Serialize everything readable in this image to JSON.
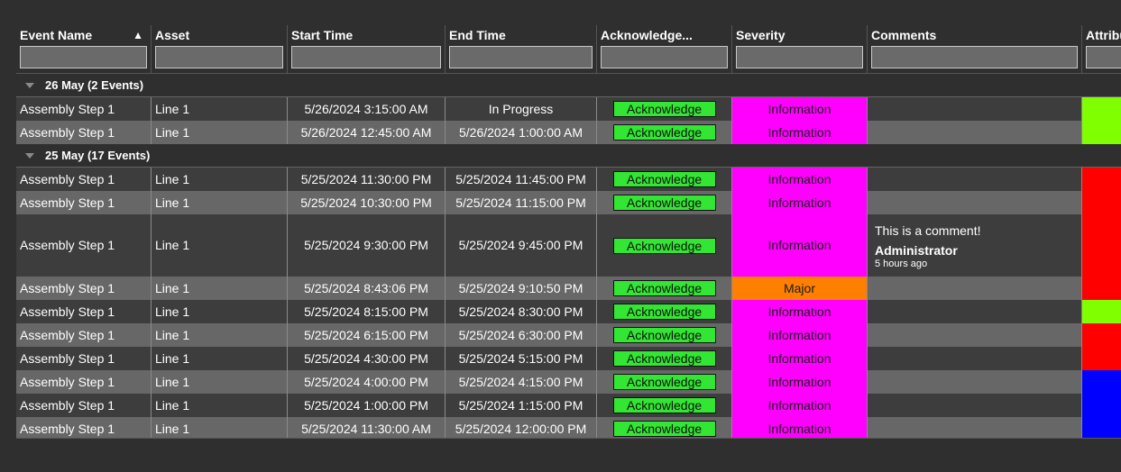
{
  "columns": [
    {
      "label": "Event Name",
      "sorted": "asc"
    },
    {
      "label": "Asset"
    },
    {
      "label": "Start Time"
    },
    {
      "label": "End Time"
    },
    {
      "label": "Acknowledge..."
    },
    {
      "label": "Severity"
    },
    {
      "label": "Comments"
    },
    {
      "label": "Attribu"
    }
  ],
  "sort_icon": "▲",
  "colors": {
    "information": "#ff00ff",
    "major": "#ff8000",
    "ack_button": "#33e633",
    "attr_green": "#80ff00",
    "attr_red": "#ff0000",
    "attr_blue": "#0000ff"
  },
  "groups": [
    {
      "label": "26 May (2 Events)",
      "rows": [
        {
          "event": "Assembly Step 1",
          "asset": "Line 1",
          "start": "5/26/2024 3:15:00 AM",
          "end": "In Progress",
          "ack": "Acknowledge",
          "severity": "Information",
          "sev_color": "#ff00ff",
          "attr_color": "#80ff00"
        },
        {
          "event": "Assembly Step 1",
          "asset": "Line 1",
          "start": "5/26/2024 12:45:00 AM",
          "end": "5/26/2024 1:00:00 AM",
          "ack": "Acknowledge",
          "severity": "Information",
          "sev_color": "#ff00ff",
          "attr_color": "#80ff00"
        }
      ]
    },
    {
      "label": "25 May (17 Events)",
      "rows": [
        {
          "event": "Assembly Step 1",
          "asset": "Line 1",
          "start": "5/25/2024 11:30:00 PM",
          "end": "5/25/2024 11:45:00 PM",
          "ack": "Acknowledge",
          "severity": "Information",
          "sev_color": "#ff00ff",
          "attr_color": "#ff0000"
        },
        {
          "event": "Assembly Step 1",
          "asset": "Line 1",
          "start": "5/25/2024 10:30:00 PM",
          "end": "5/25/2024 11:15:00 PM",
          "ack": "Acknowledge",
          "severity": "Information",
          "sev_color": "#ff00ff",
          "attr_color": "#ff0000"
        },
        {
          "event": "Assembly Step 1",
          "asset": "Line 1",
          "start": "5/25/2024 9:30:00 PM",
          "end": "5/25/2024 9:45:00 PM",
          "ack": "Acknowledge",
          "severity": "Information",
          "sev_color": "#ff00ff",
          "attr_color": "#ff0000",
          "comment": {
            "text": "This is a comment!",
            "author": "Administrator",
            "time": "5 hours ago"
          }
        },
        {
          "event": "Assembly Step 1",
          "asset": "Line 1",
          "start": "5/25/2024 8:43:06 PM",
          "end": "5/25/2024 9:10:50 PM",
          "ack": "Acknowledge",
          "severity": "Major",
          "sev_color": "#ff8000",
          "attr_color": "#ff0000"
        },
        {
          "event": "Assembly Step 1",
          "asset": "Line 1",
          "start": "5/25/2024 8:15:00 PM",
          "end": "5/25/2024 8:30:00 PM",
          "ack": "Acknowledge",
          "severity": "Information",
          "sev_color": "#ff00ff",
          "attr_color": "#80ff00"
        },
        {
          "event": "Assembly Step 1",
          "asset": "Line 1",
          "start": "5/25/2024 6:15:00 PM",
          "end": "5/25/2024 6:30:00 PM",
          "ack": "Acknowledge",
          "severity": "Information",
          "sev_color": "#ff00ff",
          "attr_color": "#ff0000"
        },
        {
          "event": "Assembly Step 1",
          "asset": "Line 1",
          "start": "5/25/2024 4:30:00 PM",
          "end": "5/25/2024 5:15:00 PM",
          "ack": "Acknowledge",
          "severity": "Information",
          "sev_color": "#ff00ff",
          "attr_color": "#ff0000"
        },
        {
          "event": "Assembly Step 1",
          "asset": "Line 1",
          "start": "5/25/2024 4:00:00 PM",
          "end": "5/25/2024 4:15:00 PM",
          "ack": "Acknowledge",
          "severity": "Information",
          "sev_color": "#ff00ff",
          "attr_color": "#0000ff"
        },
        {
          "event": "Assembly Step 1",
          "asset": "Line 1",
          "start": "5/25/2024 1:00:00 PM",
          "end": "5/25/2024 1:15:00 PM",
          "ack": "Acknowledge",
          "severity": "Information",
          "sev_color": "#ff00ff",
          "attr_color": "#0000ff"
        },
        {
          "event": "Assembly Step 1",
          "asset": "Line 1",
          "start": "5/25/2024 11:30:00 AM",
          "end": "5/25/2024 12:00:00 PM",
          "ack": "Acknowledge",
          "severity": "Information",
          "sev_color": "#ff00ff",
          "attr_color": "#0000ff"
        }
      ]
    }
  ]
}
